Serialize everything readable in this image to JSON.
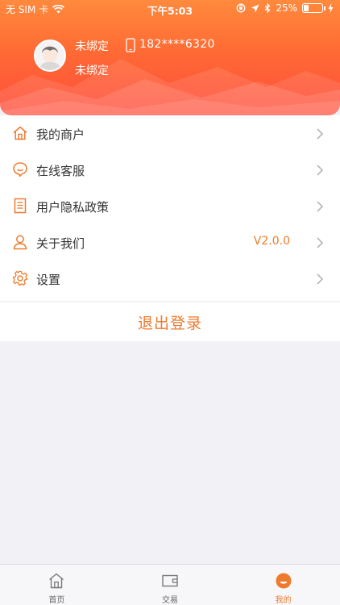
{
  "status_bar": {
    "carrier": "无 SIM 卡",
    "time": "下午5:03",
    "battery_percent": "25%",
    "battery_level": 0.25
  },
  "profile": {
    "name": "未绑定",
    "phone": "182****6320",
    "merchant": "未绑定"
  },
  "menu": {
    "items": [
      {
        "label": "我的商户",
        "icon": "home-icon",
        "value": ""
      },
      {
        "label": "在线客服",
        "icon": "chat-bubble-icon",
        "value": ""
      },
      {
        "label": "用户隐私政策",
        "icon": "document-icon",
        "value": ""
      },
      {
        "label": "关于我们",
        "icon": "user-icon",
        "value": "V2.0.0"
      },
      {
        "label": "设置",
        "icon": "gear-icon",
        "value": ""
      }
    ]
  },
  "logout_label": "退出登录",
  "tabbar": {
    "tabs": [
      {
        "label": "首页",
        "icon": "home-tab-icon",
        "active": false
      },
      {
        "label": "交易",
        "icon": "wallet-icon",
        "active": false
      },
      {
        "label": "我的",
        "icon": "profile-tab-icon",
        "active": true
      }
    ]
  },
  "colors": {
    "accent": "#ef7a2e",
    "header_top": "#ff8a3d",
    "header_bottom": "#ff4d3c",
    "background": "#f2f2f6"
  }
}
